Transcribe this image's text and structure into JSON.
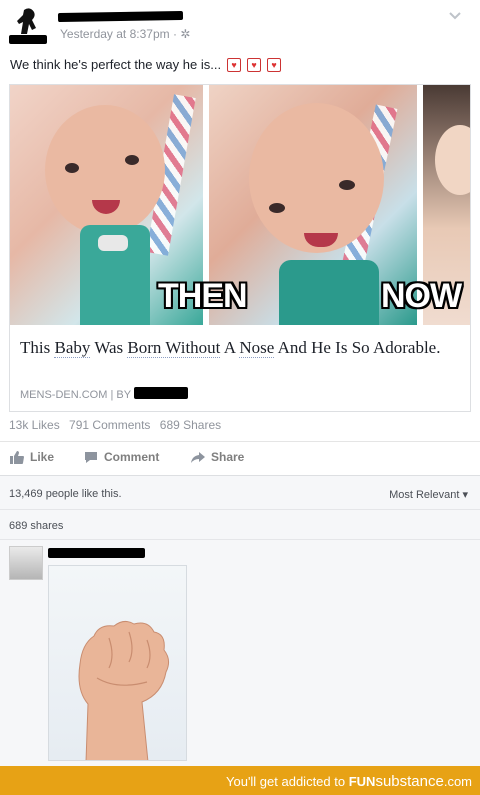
{
  "post": {
    "timestamp": "Yesterday at 8:37pm",
    "privacy_icon": "gear-icon",
    "message": "We think he's perfect the way he is...",
    "emoji": "heart-icon"
  },
  "card": {
    "overlay_left": "THEN",
    "overlay_right": "NOW",
    "title_parts": [
      "This ",
      "Baby",
      " Was ",
      "Born Without",
      " A ",
      "Nose",
      " And He Is So Adorable."
    ],
    "source": "MENS-DEN.COM | BY"
  },
  "stats": {
    "likes": "13k Likes",
    "comments": "791 Comments",
    "shares": "689 Shares"
  },
  "actions": {
    "like": "Like",
    "comment": "Comment",
    "share": "Share"
  },
  "comments": {
    "likes_text": "13,469 people like this.",
    "sort": "Most Relevant",
    "shares_text": "689 shares"
  },
  "footer": {
    "prefix": "You'll get addicted to ",
    "brand_bold": "FUN",
    "brand_rest": "substance",
    "brand_tld": ".com"
  },
  "colors": {
    "footer_bg": "#e7a215",
    "link": "#4b67a1"
  }
}
